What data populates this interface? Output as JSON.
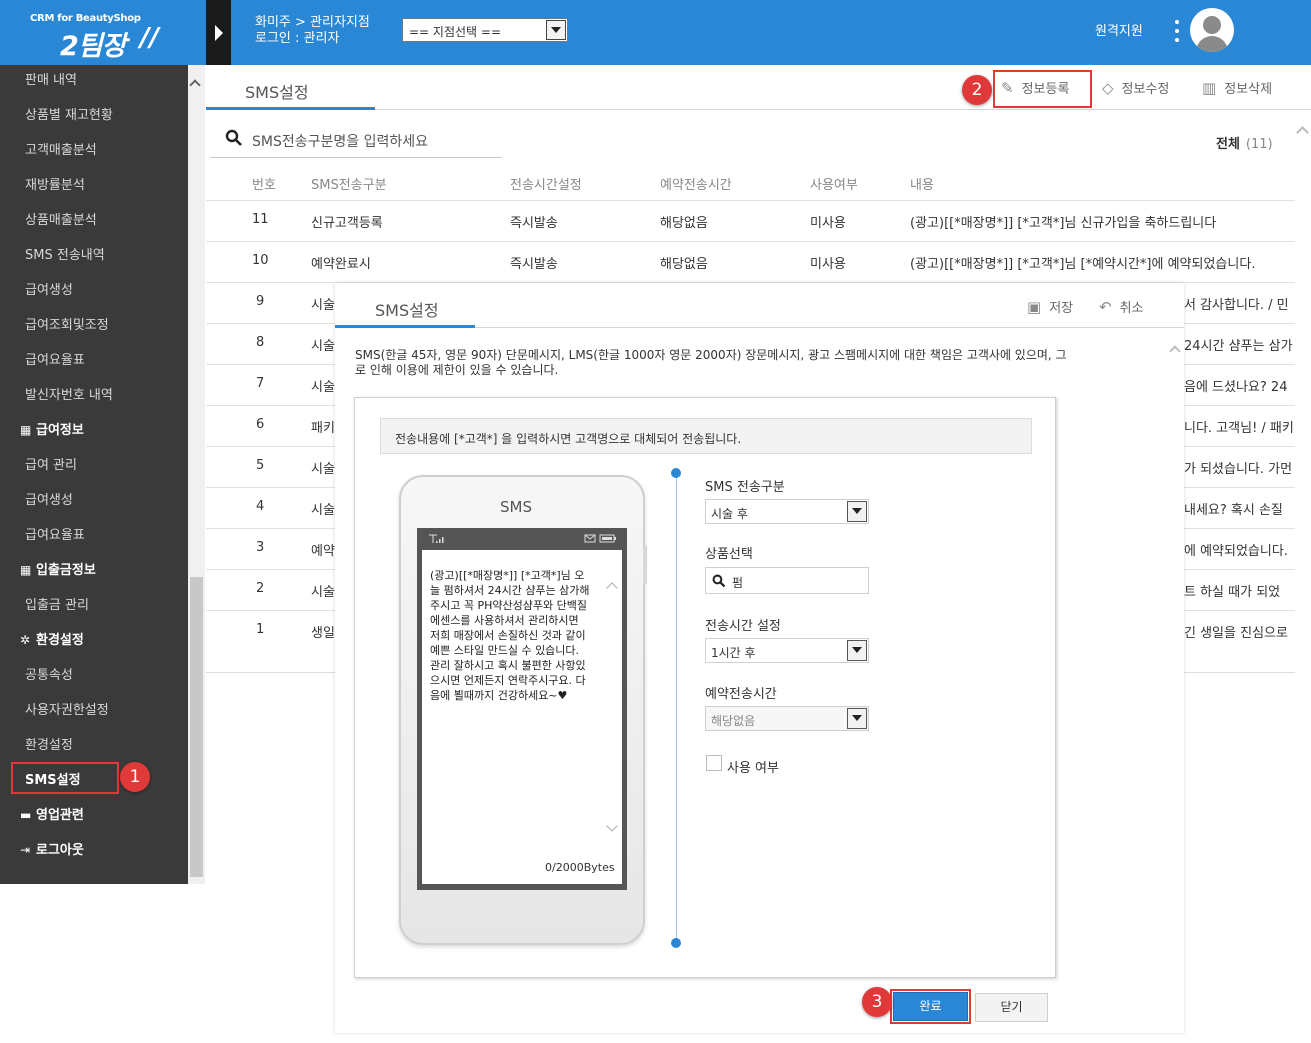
{
  "header": {
    "logo_small": "CRM for BeautyShop",
    "logo_big": "2팀장",
    "shop_name": "화미주 > 관리자지점",
    "login_info": "로그인 : 관리자",
    "branch_select": "== 지점선택 ==",
    "remote_support": "원격지원"
  },
  "sidebar": {
    "items": [
      {
        "label": "판매 내역"
      },
      {
        "label": "상품별 재고현황"
      },
      {
        "label": "고객매출분석"
      },
      {
        "label": "재방률분석"
      },
      {
        "label": "상품매출분석"
      },
      {
        "label": "SMS 전송내역"
      },
      {
        "label": "급여생성"
      },
      {
        "label": "급여조회및조정"
      },
      {
        "label": "급여요율표"
      },
      {
        "label": "발신자번호 내역"
      },
      {
        "label": "급여정보",
        "group": true,
        "icon": "calculator-icon"
      },
      {
        "label": "급여 관리"
      },
      {
        "label": "급여생성"
      },
      {
        "label": "급여요율표"
      },
      {
        "label": "입출금정보",
        "group": true,
        "icon": "calculator-icon"
      },
      {
        "label": "입출금 관리"
      },
      {
        "label": "환경설정",
        "group": true,
        "icon": "gears-icon"
      },
      {
        "label": "공통속성"
      },
      {
        "label": "사용자권한설정"
      },
      {
        "label": "환경설정"
      },
      {
        "label": "SMS설정",
        "active": true
      },
      {
        "label": "영업관련",
        "group": true,
        "icon": "briefcase-icon"
      },
      {
        "label": "로그아웃",
        "group": true,
        "icon": "logout-icon"
      }
    ]
  },
  "badges": {
    "b1": "1",
    "b2": "2",
    "b3": "3"
  },
  "main": {
    "tab": "SMS설정",
    "toolbar": {
      "register": "정보등록",
      "edit": "정보수정",
      "delete": "정보삭제"
    },
    "search_placeholder": "SMS전송구분명을 입력하세요",
    "total_label": "전체",
    "total_count": "(11)",
    "table": {
      "headers": [
        "번호",
        "SMS전송구분",
        "전송시간설정",
        "예약전송시간",
        "사용여부",
        "내용"
      ],
      "rows": [
        [
          "11",
          "신규고객등록",
          "즉시발송",
          "해당없음",
          "미사용",
          "(광고)[[*매장명*]] [*고객*]님 신규가입을 축하드립니다"
        ],
        [
          "10",
          "예약완료시",
          "즉시발송",
          "해당없음",
          "미사용",
          "(광고)[[*매장명*]] [*고객*]님 [*예약시간*]에 예약되었습니다."
        ],
        [
          "9",
          "시술",
          "",
          "",
          "",
          "서 감사합니다. / 민"
        ],
        [
          "8",
          "시술",
          "",
          "",
          "",
          "24시간 샴푸는 삼가"
        ],
        [
          "7",
          "시술",
          "",
          "",
          "",
          "음에 드셨나요? 24"
        ],
        [
          "6",
          "패키",
          "",
          "",
          "",
          "니다. 고객님! / 패키"
        ],
        [
          "5",
          "시술",
          "",
          "",
          "",
          "가 되셨습니다. 가먼"
        ],
        [
          "4",
          "시술",
          "",
          "",
          "",
          "내세요? 혹시 손질"
        ],
        [
          "3",
          "예약",
          "",
          "",
          "",
          "에 예약되었습니다."
        ],
        [
          "2",
          "시술",
          "",
          "",
          "",
          "트 하실 때가 되었"
        ],
        [
          "1",
          "생일",
          "",
          "",
          "",
          "긴 생일을 진심으로"
        ]
      ]
    }
  },
  "modal": {
    "tab": "SMS설정",
    "save": "저장",
    "cancel": "취소",
    "notice": "SMS(한글 45자, 영문 90자) 단문메시지, LMS(한글 1000자 영문 2000자) 장문메시지, 광고 스팸메시지에 대한 책임은 고객사에 있으며, 그로 인해 이용에 제한이 있을 수 있습니다.",
    "hint": "전송내용에 [*고객*] 을 입력하시면 고객명으로 대체되어 전송됩니다.",
    "phone_title": "SMS",
    "message": "(광고)[[*매장명*]] [*고객*]님 오늘 펌하셔서 24시간 샴푸는 삼가해 주시고 꼭 PH약산성샴푸와 단백질 에센스를 사용하셔서 관리하시면 저희 매장에서 손질하신 것과 같이 예쁜 스타일 만드실 수 있습니다. 관리 잘하시고 혹시 불편한 사항있으시면 언제든지 연락주시구요. 다음에 뵐때까지 건강하세요~♥",
    "bytes": "0/2000Bytes",
    "form": {
      "sms_type_label": "SMS 전송구분",
      "sms_type_value": "시술 후",
      "product_label": "상품선택",
      "product_value": "펌",
      "send_time_label": "전송시간 설정",
      "send_time_value": "1시간 후",
      "reserve_label": "예약전송시간",
      "reserve_value": "해당없음",
      "use_label": "사용 여부"
    },
    "done": "완료",
    "close": "닫기"
  },
  "colors": {
    "brand": "#2a87d6",
    "sidebar": "#3a3a3a",
    "highlight": "#e0393a"
  }
}
